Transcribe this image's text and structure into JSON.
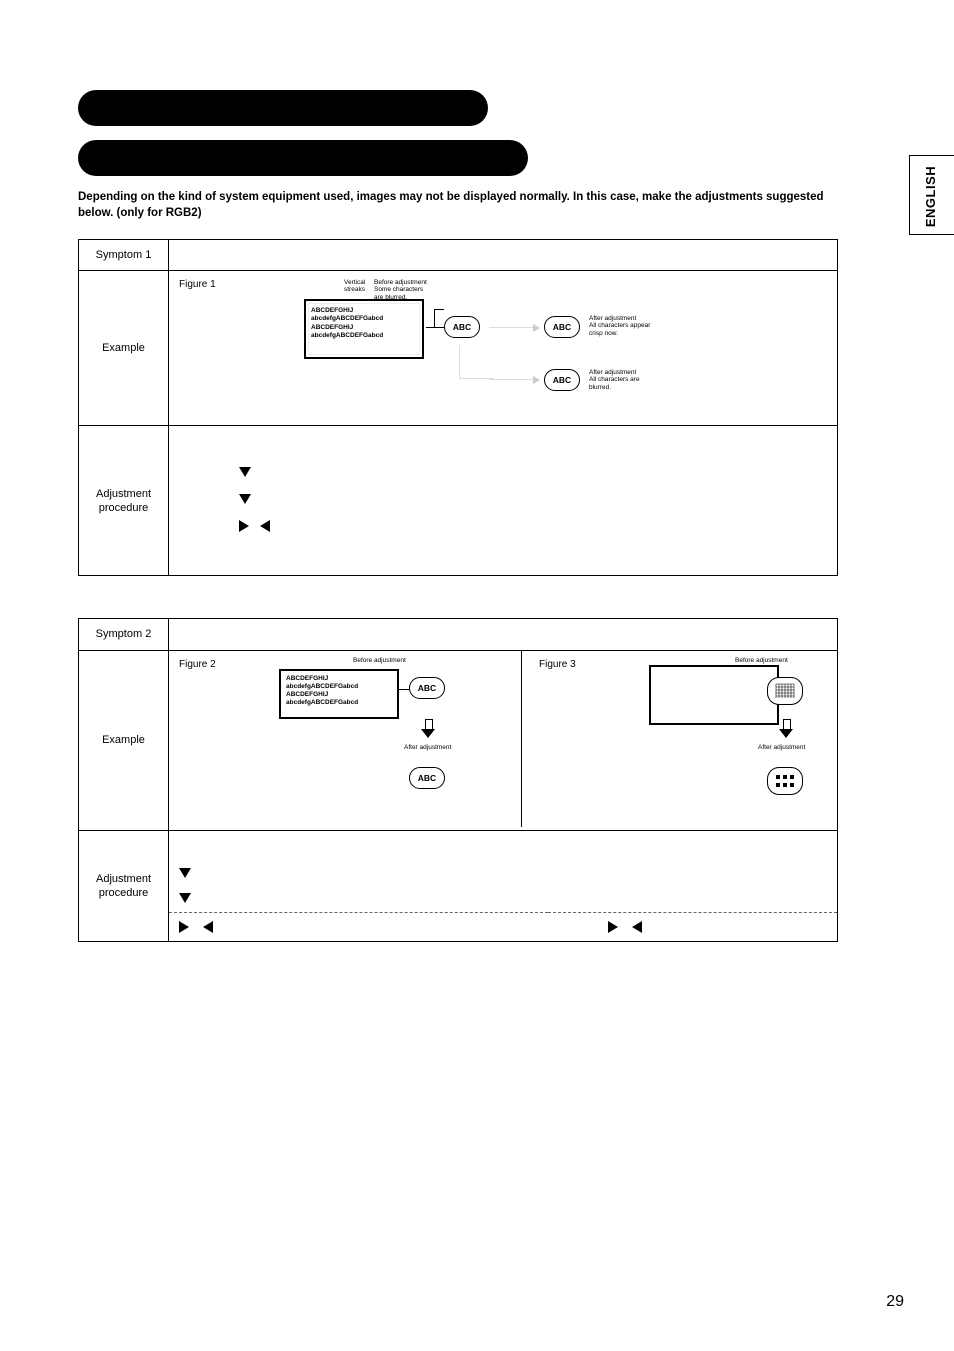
{
  "side_tab": "ENGLISH",
  "page_number": "29",
  "intro": "Depending on the kind of system equipment used, images may not be displayed normally.  In this case, make the adjustments suggested below. (only for RGB2)",
  "labels": {
    "symptom": "Symptom",
    "example": "Example",
    "adjustment_procedure": "Adjustment\nprocedure",
    "figure": "Figure"
  },
  "table1": {
    "symptom_no": "1",
    "figure_no": "1",
    "diagram": {
      "vertical_streaks": "Vertical\nstreaks",
      "before": "Before adjustment\nSome characters\nare blurred.",
      "box_lines": [
        "ABCDEFGHIJ",
        "abcdefgABCDEFGabcd",
        "ABCDEFGHIJ",
        "abcdefgABCDEFGabcd"
      ],
      "abc": "ABC",
      "after_good": "After adjustment\nAll characters appear\ncrisp now.",
      "after_bad": "After adjustment\nAll characters are\nblurred."
    }
  },
  "table2": {
    "symptom_no": "2",
    "fig2": {
      "no": "2",
      "before": "Before adjustment",
      "after": "After adjustment",
      "box_lines": [
        "ABCDEFGHIJ",
        "abcdefgABCDEFGabcd",
        "ABCDEFGHIJ",
        "abcdefgABCDEFGabcd"
      ],
      "abc": "ABC"
    },
    "fig3": {
      "no": "3",
      "before": "Before adjustment",
      "after": "After adjustment"
    }
  }
}
